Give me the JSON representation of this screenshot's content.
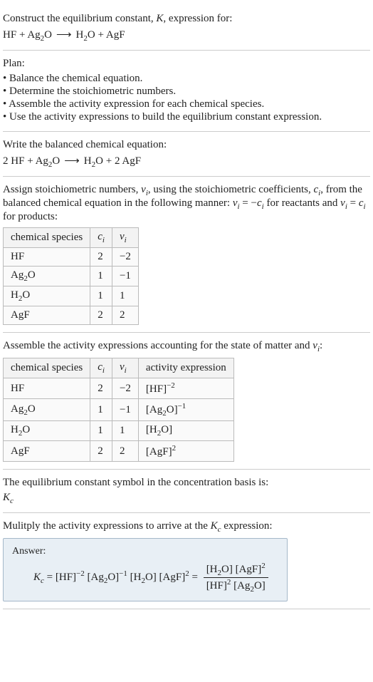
{
  "intro": {
    "line1_a": "Construct the equilibrium constant, ",
    "line1_b": ", expression for:",
    "eq_lhs_hf": "HF",
    "plus": " + ",
    "eq_lhs_ag2o_a": "Ag",
    "eq_lhs_ag2o_b": "2",
    "eq_lhs_ag2o_c": "O",
    "arrow": "⟶",
    "eq_rhs_h2o_a": "H",
    "eq_rhs_h2o_b": "2",
    "eq_rhs_h2o_c": "O",
    "eq_rhs_agf": "AgF"
  },
  "plan": {
    "title": "Plan:",
    "b1": "• Balance the chemical equation.",
    "b2": "• Determine the stoichiometric numbers.",
    "b3": "• Assemble the activity expression for each chemical species.",
    "b4": "• Use the activity expressions to build the equilibrium constant expression."
  },
  "balanced": {
    "title": "Write the balanced chemical equation:",
    "c_hf": "2 HF",
    "c_ag2o_a": "Ag",
    "c_ag2o_b": "2",
    "c_ag2o_c": "O",
    "c_h2o_a": "H",
    "c_h2o_b": "2",
    "c_h2o_c": "O",
    "c_agf": "2 AgF"
  },
  "assign": {
    "t1": "Assign stoichiometric numbers, ",
    "nu": "ν",
    "i": "i",
    "t2": ", using the stoichiometric coefficients, ",
    "c": "c",
    "t3": ", from the balanced chemical equation in the following manner: ",
    "eqneg": " = −",
    "t4": " for reactants and ",
    "eqpos": " = ",
    "t5": " for products:",
    "h_species": "chemical species",
    "r1_s": "HF",
    "r1_c": "2",
    "r1_n": "−2",
    "r2_s_a": "Ag",
    "r2_s_b": "2",
    "r2_s_c": "O",
    "r2_c": "1",
    "r2_n": "−1",
    "r3_s_a": "H",
    "r3_s_b": "2",
    "r3_s_c": "O",
    "r3_c": "1",
    "r3_n": "1",
    "r4_s": "AgF",
    "r4_c": "2",
    "r4_n": "2"
  },
  "activity": {
    "title_a": "Assemble the activity expressions accounting for the state of matter and ",
    "title_b": ":",
    "h_species": "chemical species",
    "h_act": "activity expression",
    "r1_s": "HF",
    "r1_c": "2",
    "r1_n": "−2",
    "r1_a": "[HF]",
    "r1_e": "−2",
    "r2_s_a": "Ag",
    "r2_s_b": "2",
    "r2_s_c": "O",
    "r2_c": "1",
    "r2_n": "−1",
    "r2_a_a": "[Ag",
    "r2_a_b": "2",
    "r2_a_c": "O]",
    "r2_e": "−1",
    "r3_s_a": "H",
    "r3_s_b": "2",
    "r3_s_c": "O",
    "r3_c": "1",
    "r3_n": "1",
    "r3_a_a": "[H",
    "r3_a_b": "2",
    "r3_a_c": "O]",
    "r4_s": "AgF",
    "r4_c": "2",
    "r4_n": "2",
    "r4_a": "[AgF]",
    "r4_e": "2"
  },
  "symbol": {
    "title": "The equilibrium constant symbol in the concentration basis is:",
    "K": "K",
    "c": "c"
  },
  "mult": {
    "title_a": "Mulitply the activity expressions to arrive at the ",
    "title_b": " expression:"
  },
  "answer": {
    "label": "Answer:",
    "eq": " = ",
    "hf": "[HF]",
    "hf_e": "−2",
    "ag_a": " [Ag",
    "ag_b": "2",
    "ag_c": "O]",
    "ag_e": "−1",
    "h2o_a": " [H",
    "h2o_b": "2",
    "h2o_c": "O] ",
    "agf": "[AgF]",
    "agf_e": "2",
    "eq2": " = ",
    "num_h2o_a": "[H",
    "num_h2o_b": "2",
    "num_h2o_c": "O] ",
    "num_agf": "[AgF]",
    "num_agf_e": "2",
    "den_hf": "[HF]",
    "den_hf_e": "2",
    "den_ag_a": " [Ag",
    "den_ag_b": "2",
    "den_ag_c": "O]"
  }
}
